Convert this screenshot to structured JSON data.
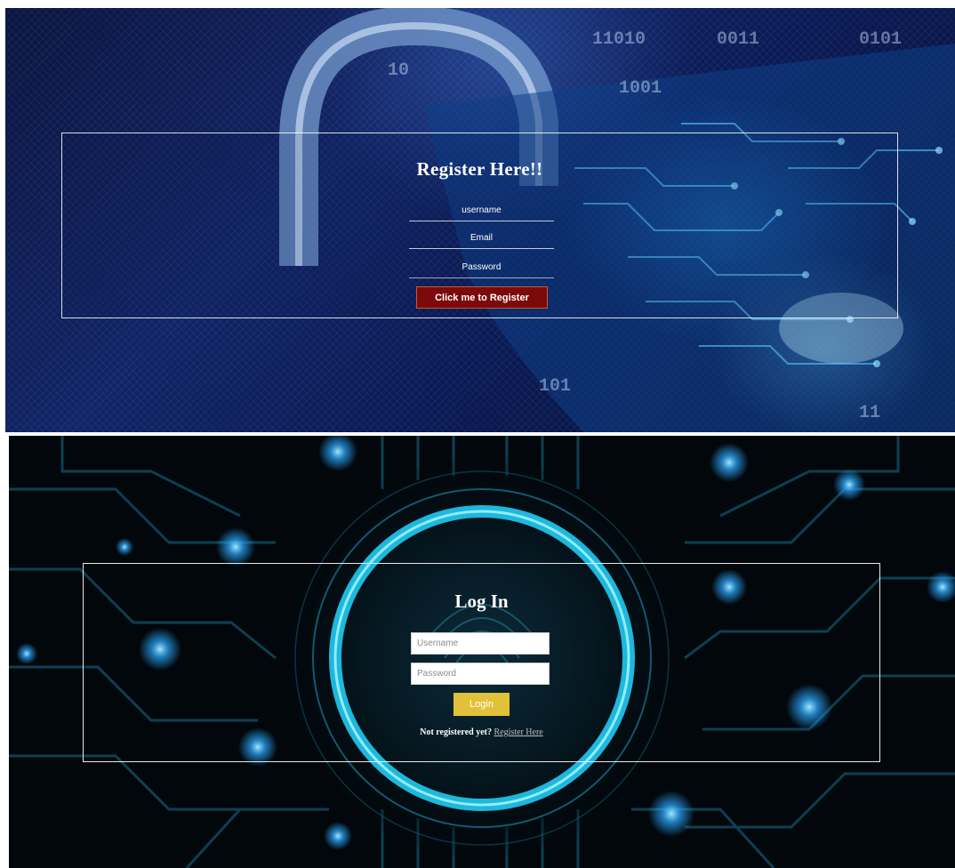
{
  "register": {
    "title": "Register Here!!",
    "username_placeholder": "username",
    "email_placeholder": "Email",
    "password_placeholder": "Password",
    "submit_label": "Click me to Register",
    "button_color": "#7d0a0a",
    "background_icon": "padlock-circuit-image"
  },
  "login": {
    "title": "Log In",
    "username_placeholder": "Username",
    "password_placeholder": "Password",
    "submit_label": "Login",
    "button_color": "#e2c13a",
    "footer_question": "Not registered yet?",
    "footer_link": "Register Here",
    "background_icon": "fingerprint-circuit-image"
  }
}
